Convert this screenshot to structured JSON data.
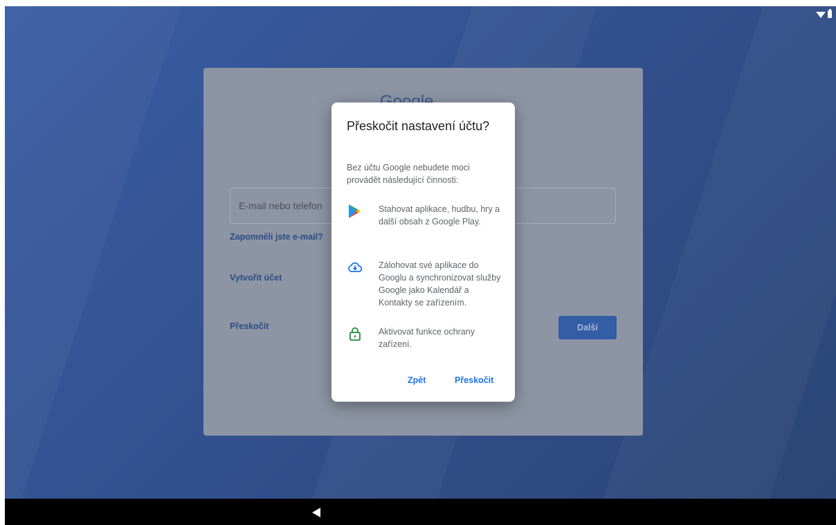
{
  "signin": {
    "logo_text": "Google",
    "email_placeholder": "E-mail nebo telefon",
    "forgot_email": "Zapomněli jste e-mail?",
    "create_account": "Vytvořit účet",
    "skip": "Přeskočit",
    "next": "Další"
  },
  "dialog": {
    "title": "Přeskočit nastavení účtu?",
    "description": "Bez účtu Google nebudete moci provádět následující činnosti:",
    "features": [
      {
        "icon": "google-play-icon",
        "text": "Stahovat aplikace, hudbu, hry a další obsah z Google Play."
      },
      {
        "icon": "cloud-backup-icon",
        "text": "Zálohovat své aplikace do Googlu a synchronizovat služby Google jako Kalendář a Kontakty se zařízením."
      },
      {
        "icon": "lock-icon",
        "text": "Aktivovat funkce ochrany zařízení."
      }
    ],
    "back_label": "Zpět",
    "skip_label": "Přeskočit"
  },
  "colors": {
    "accent": "#1a73e8",
    "background": "#33518f",
    "lock_green": "#1e8e3e"
  }
}
